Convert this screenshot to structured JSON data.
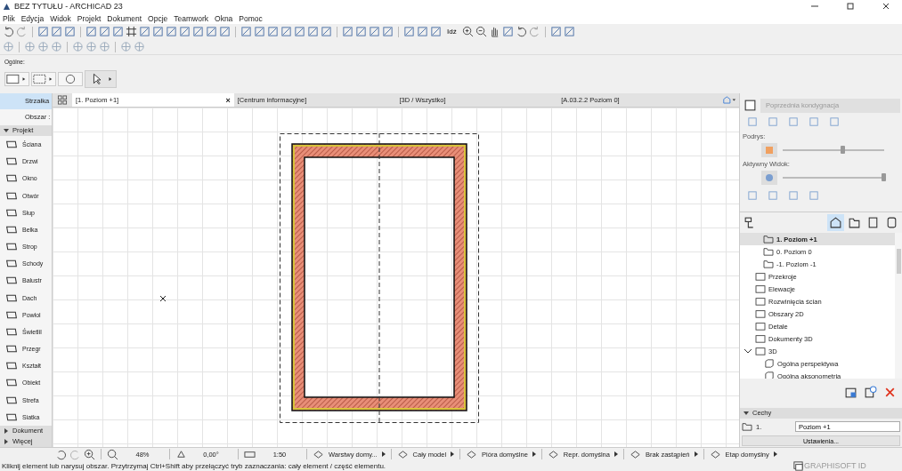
{
  "window": {
    "title": "BEZ TYTUŁU - ARCHICAD 23"
  },
  "menu": [
    "Plik",
    "Edycja",
    "Widok",
    "Projekt",
    "Dokument",
    "Opcje",
    "Teamwork",
    "Okna",
    "Pomoc"
  ],
  "toolbar": {
    "goto_label": "Idź"
  },
  "info_box": {
    "label": "Ogólne:"
  },
  "toolbox": {
    "top": [
      {
        "label": "Strzałka",
        "selected": true
      },
      {
        "label": "Obszar :",
        "selected": false
      }
    ],
    "sections": [
      {
        "label": "Projekt",
        "expanded": true,
        "tools": [
          "Ściana",
          "Drzwi",
          "Okno",
          "Otwór",
          "Słup",
          "Belka",
          "Strop",
          "Schody",
          "Balustr",
          "Dach",
          "Powłol",
          "Świetlil",
          "Przegr",
          "Kształt",
          "Obiekt",
          "Strefa",
          "Siatka"
        ]
      },
      {
        "label": "Dokument",
        "expanded": false
      },
      {
        "label": "Więcej",
        "expanded": false
      }
    ]
  },
  "tabs": [
    {
      "label": "[1. Poziom +1]",
      "selected": true,
      "close": "×"
    },
    {
      "label": "[Centrum informacyjne]",
      "selected": false
    },
    {
      "label": "[3D / Wszystko]",
      "selected": false
    },
    {
      "label": "[A.03.2.2 Poziom 0]",
      "selected": false
    }
  ],
  "nav_bar": {
    "zoom": "48%",
    "angle": "0,00°",
    "scale": "1:50",
    "items": [
      "Warstwy domy...",
      "Cały model",
      "Pióra domyślne",
      "Repr. domyślna",
      "Brak zastąpień",
      "Etap domyślny"
    ]
  },
  "status_bar": {
    "message": "Kliknij element lub narysuj obszar. Przytrzymaj Ctrl+Shift aby przełączyć tryb zaznaczania: cały element / część elementu.",
    "account": "GRAPHISOFT ID"
  },
  "trace_panel": {
    "previous": "Poprzednia kondygnacja",
    "previous_disabled": true,
    "trace": {
      "label": "Podrys:",
      "level": 0.6
    },
    "active_view": {
      "label": "Aktywny Widok:",
      "level": 1.0
    }
  },
  "navigator": {
    "stories": [
      {
        "label": "1. Poziom +1",
        "selected": true
      },
      {
        "label": "0. Poziom 0",
        "selected": false
      },
      {
        "label": "-1. Poziom -1",
        "selected": false
      }
    ],
    "tree": [
      {
        "label": "Przekroje",
        "expanded": false
      },
      {
        "label": "Elewacje",
        "expanded": false
      },
      {
        "label": "Rozwinięcia ścian",
        "expanded": false
      },
      {
        "label": "Obszary 2D",
        "expanded": false
      },
      {
        "label": "Detale",
        "expanded": false
      },
      {
        "label": "Dokumenty 3D",
        "expanded": false
      },
      {
        "label": "3D",
        "expanded": true,
        "children": [
          {
            "label": "Ogólna perspektywa"
          },
          {
            "label": "Ogólna aksonometria"
          }
        ]
      }
    ]
  },
  "properties": {
    "header": "Cechy",
    "id": "1.",
    "name": "Poziom +1",
    "settings": "Ustawienia..."
  }
}
